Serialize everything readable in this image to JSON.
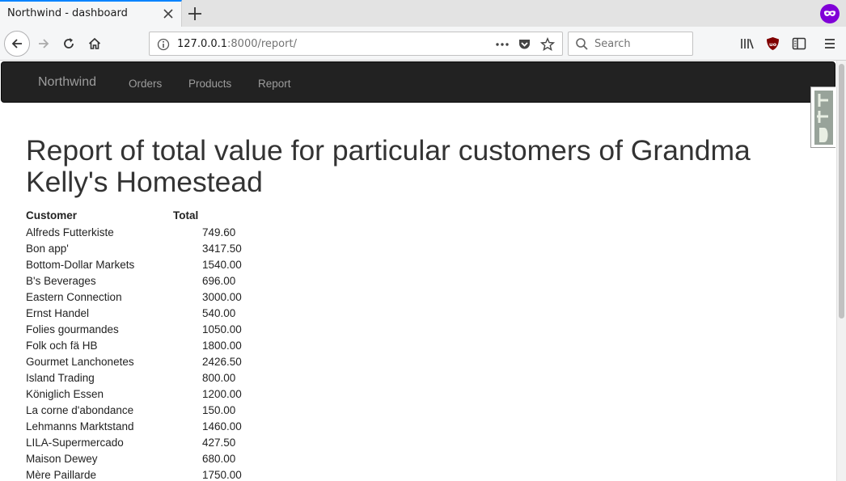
{
  "browser": {
    "tab_title": "Northwind - dashboard",
    "url_host": "127.0.0.1",
    "url_rest": ":8000/report/",
    "search_placeholder": "Search",
    "accent": "#0a84ff"
  },
  "site": {
    "brand": "Northwind",
    "nav": [
      "Orders",
      "Products",
      "Report"
    ]
  },
  "page": {
    "title": "Report of total value for particular customers of Grandma Kelly's Homestead",
    "columns": [
      "Customer",
      "Total"
    ],
    "rows": [
      {
        "customer": "Alfreds Futterkiste",
        "total": "749.60"
      },
      {
        "customer": "Bon app'",
        "total": "3417.50"
      },
      {
        "customer": "Bottom-Dollar Markets",
        "total": "1540.00"
      },
      {
        "customer": "B's Beverages",
        "total": "696.00"
      },
      {
        "customer": "Eastern Connection",
        "total": "3000.00"
      },
      {
        "customer": "Ernst Handel",
        "total": "540.00"
      },
      {
        "customer": "Folies gourmandes",
        "total": "1050.00"
      },
      {
        "customer": "Folk och fä HB",
        "total": "1800.00"
      },
      {
        "customer": "Gourmet Lanchonetes",
        "total": "2426.50"
      },
      {
        "customer": "Island Trading",
        "total": "800.00"
      },
      {
        "customer": "Königlich Essen",
        "total": "1200.00"
      },
      {
        "customer": "La corne d'abondance",
        "total": "150.00"
      },
      {
        "customer": "Lehmanns Marktstand",
        "total": "1460.00"
      },
      {
        "customer": "LILA-Supermercado",
        "total": "427.50"
      },
      {
        "customer": "Maison Dewey",
        "total": "680.00"
      },
      {
        "customer": "Mère Paillarde",
        "total": "1750.00"
      }
    ]
  }
}
